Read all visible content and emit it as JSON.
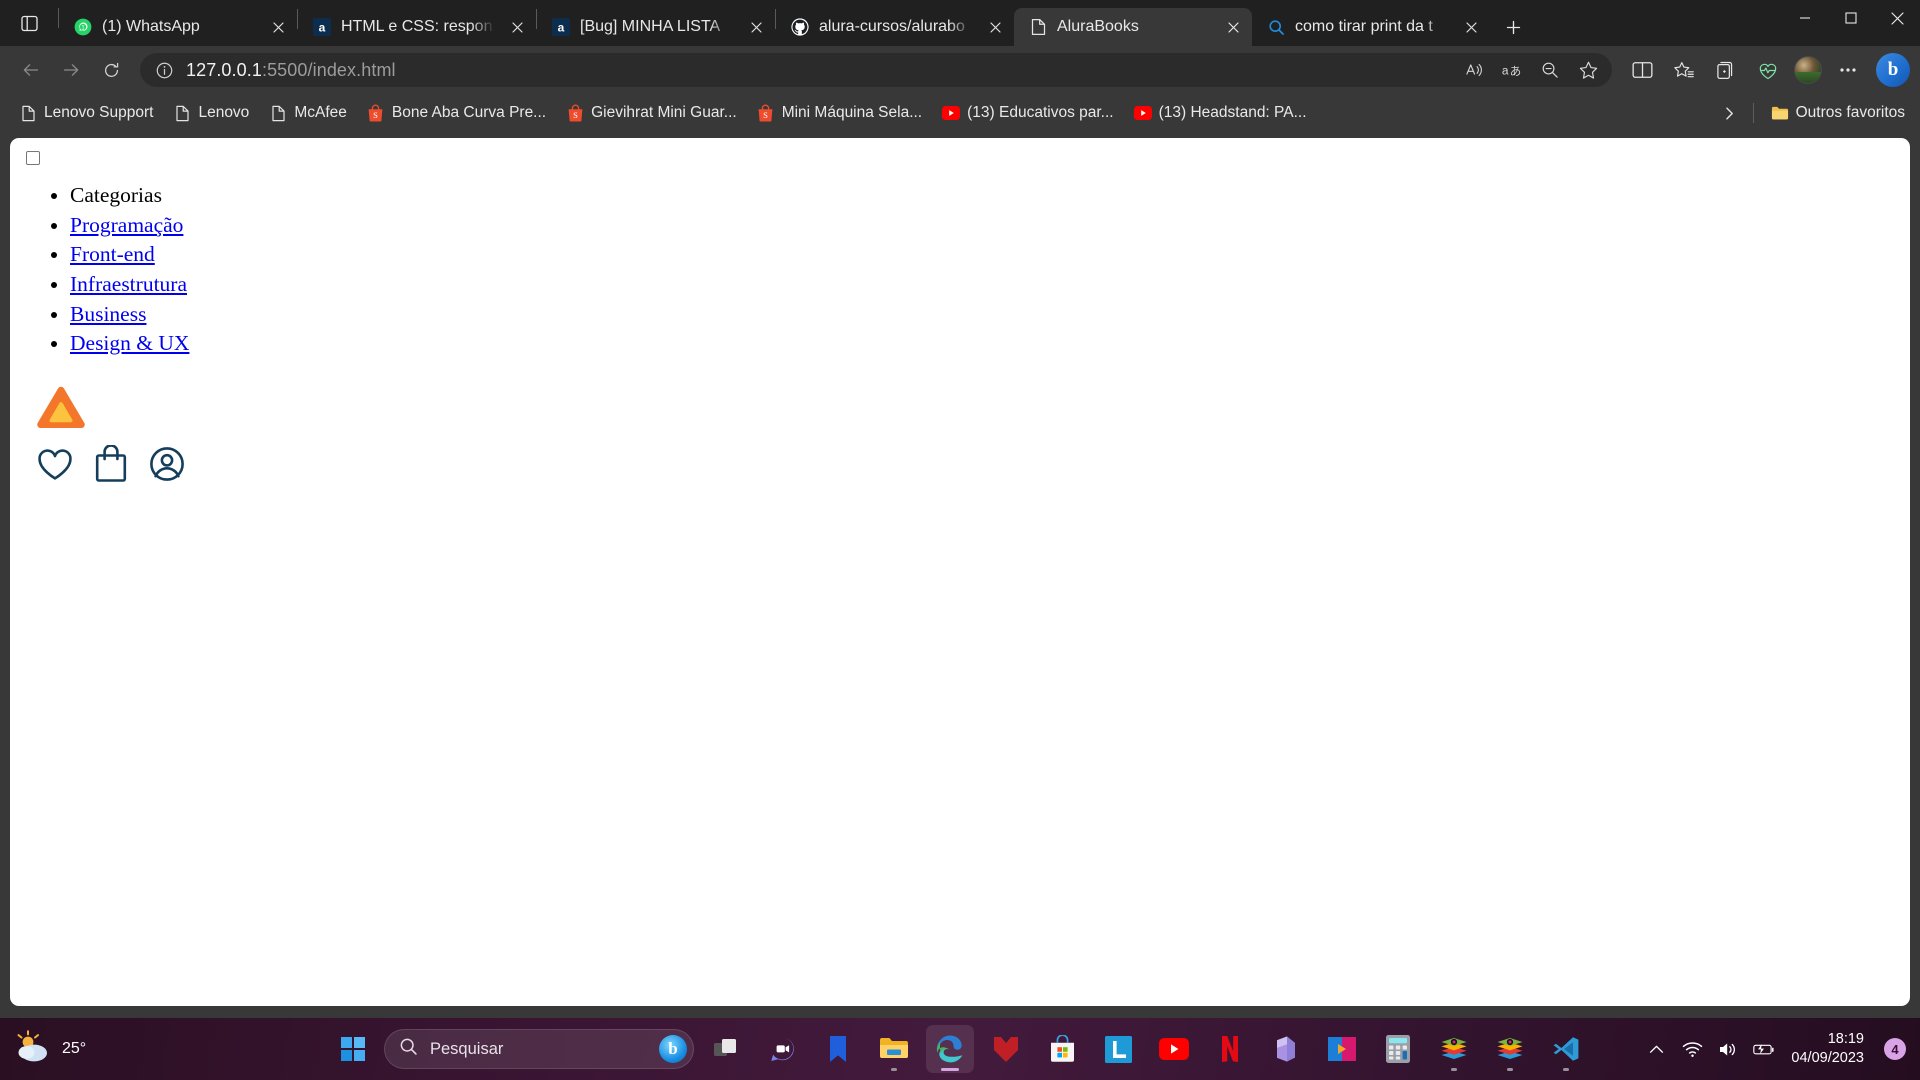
{
  "browser": {
    "name": "Microsoft Edge",
    "tabsearch_icon": "tab-search-icon",
    "tabs": [
      {
        "favicon": "whatsapp-icon",
        "title": "(1) WhatsApp",
        "active": false
      },
      {
        "favicon": "alura-icon",
        "title": "HTML e CSS: respon",
        "active": false
      },
      {
        "favicon": "alura-icon",
        "title": "[Bug] MINHA LISTA",
        "active": false
      },
      {
        "favicon": "github-icon",
        "title": "alura-cursos/alurabo",
        "active": false
      },
      {
        "favicon": "document-icon",
        "title": "AluraBooks",
        "active": true
      },
      {
        "favicon": "search-icon",
        "title": "como tirar print da t",
        "active": false
      }
    ],
    "new_tab_label": "+",
    "window_controls": {
      "minimize": "minimize-icon",
      "maximize": "maximize-icon",
      "close": "close-icon"
    },
    "toolbar": {
      "back": "back-arrow-icon",
      "forward": "forward-arrow-icon",
      "refresh": "refresh-icon",
      "site_info": "info-icon",
      "url_host": "127.0.0.1",
      "url_path": ":5500/index.html",
      "url_full": "127.0.0.1:5500/index.html",
      "read_aloud": "read-aloud-icon",
      "translate": "translate-icon",
      "zoom_out": "zoom-out-icon",
      "favorite": "star-icon",
      "split_screen": "split-screen-icon",
      "favorites_list": "favorites-icon",
      "collections": "collections-icon",
      "browser_essentials": "browser-essentials-icon",
      "profile": "profile-avatar",
      "settings_more": "more-options-icon",
      "copilot": "copilot-icon"
    },
    "bookmarks": {
      "items": [
        {
          "icon": "document-icon",
          "label": "Lenovo Support"
        },
        {
          "icon": "document-icon",
          "label": "Lenovo"
        },
        {
          "icon": "document-icon",
          "label": "McAfee"
        },
        {
          "icon": "shopee-icon",
          "label": "Bone Aba Curva Pre..."
        },
        {
          "icon": "shopee-icon",
          "label": "Gievihrat Mini Guar..."
        },
        {
          "icon": "shopee-icon",
          "label": "Mini Máquina Sela..."
        },
        {
          "icon": "youtube-icon",
          "label": "(13) Educativos par..."
        },
        {
          "icon": "youtube-icon",
          "label": "(13) Headstand: PA..."
        }
      ],
      "overflow_icon": "chevron-right-icon",
      "other_favorites": {
        "icon": "folder-icon",
        "label": "Outros favoritos"
      }
    }
  },
  "page": {
    "title": "AluraBooks",
    "checkbox_checked": false,
    "nav_heading": "Categorias",
    "nav_links": [
      "Programação",
      "Front-end",
      "Infraestrutura",
      "Business",
      "Design & UX"
    ],
    "logo": {
      "name": "alura-logo",
      "outer_color": "#f4762a",
      "inner_color": "#fcc43e"
    },
    "icons": [
      {
        "name": "favorites-heart-icon",
        "color": "#153e5c"
      },
      {
        "name": "shopping-bag-icon",
        "color": "#153e5c"
      },
      {
        "name": "user-account-icon",
        "color": "#153e5c"
      }
    ],
    "link_color": "#0000ee"
  },
  "taskbar": {
    "weather": {
      "icon": "partly-cloudy-icon",
      "temperature": "25°"
    },
    "start": "windows-start-icon",
    "search": {
      "icon": "search-icon",
      "placeholder": "Pesquisar",
      "assistant": "bing-chat-icon"
    },
    "apps": [
      {
        "name": "task-view-icon",
        "running": false,
        "active": false
      },
      {
        "name": "teams-chat-icon",
        "running": false,
        "active": false
      },
      {
        "name": "bookmark-app-icon",
        "running": false,
        "active": false
      },
      {
        "name": "file-explorer-icon",
        "running": true,
        "active": false
      },
      {
        "name": "microsoft-edge-icon",
        "running": true,
        "active": true
      },
      {
        "name": "mcafee-icon",
        "running": false,
        "active": false
      },
      {
        "name": "microsoft-store-icon",
        "running": false,
        "active": false
      },
      {
        "name": "lenovo-vantage-icon",
        "running": false,
        "active": false
      },
      {
        "name": "youtube-icon",
        "running": false,
        "active": false
      },
      {
        "name": "netflix-icon",
        "running": false,
        "active": false
      },
      {
        "name": "microsoft-365-icon",
        "running": false,
        "active": false
      },
      {
        "name": "clipchamp-icon",
        "running": false,
        "active": false
      },
      {
        "name": "calculator-icon",
        "running": false,
        "active": false
      },
      {
        "name": "live-server-icon",
        "running": true,
        "active": false
      },
      {
        "name": "live-server-icon-2",
        "running": true,
        "active": false
      },
      {
        "name": "vs-code-icon",
        "running": true,
        "active": false
      }
    ],
    "tray": {
      "show_hidden": "chevron-up-icon",
      "network": "wifi-icon",
      "volume": "speaker-icon",
      "battery": "battery-charging-icon",
      "time": "18:19",
      "date": "04/09/2023",
      "notification_count": "4"
    }
  }
}
